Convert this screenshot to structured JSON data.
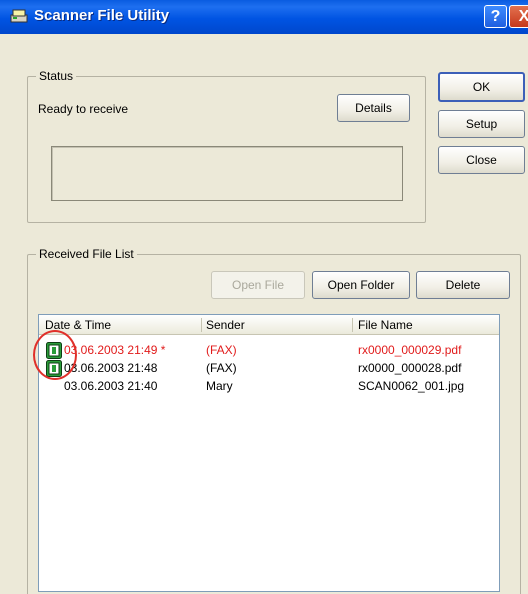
{
  "window": {
    "title": "Scanner File Utility",
    "help_label": "?",
    "close_label": "X"
  },
  "status": {
    "legend": "Status",
    "message": "Ready to receive",
    "details_label": "Details"
  },
  "side_buttons": {
    "ok_label": "OK",
    "setup_label": "Setup",
    "close_label": "Close"
  },
  "received": {
    "legend": "Received File List",
    "open_file_label": "Open File",
    "open_folder_label": "Open Folder",
    "delete_label": "Delete",
    "columns": [
      "Date & Time",
      "Sender",
      "File Name"
    ],
    "rows": [
      {
        "datetime": "03.06.2003 21:49 *",
        "sender": "(FAX)",
        "filename": "rx0000_000029.pdf",
        "unread": true,
        "icon": "fax-document-icon"
      },
      {
        "datetime": "03.06.2003 21:48",
        "sender": "(FAX)",
        "filename": "rx0000_000028.pdf",
        "unread": false,
        "icon": "fax-document-icon"
      },
      {
        "datetime": "03.06.2003 21:40",
        "sender": "Mary",
        "filename": "SCAN0062_001.jpg",
        "unread": false,
        "icon": ""
      }
    ]
  },
  "colors": {
    "unread": "#e11b1b",
    "titlebar": "#0054e3",
    "highlight": "#e0302a"
  }
}
